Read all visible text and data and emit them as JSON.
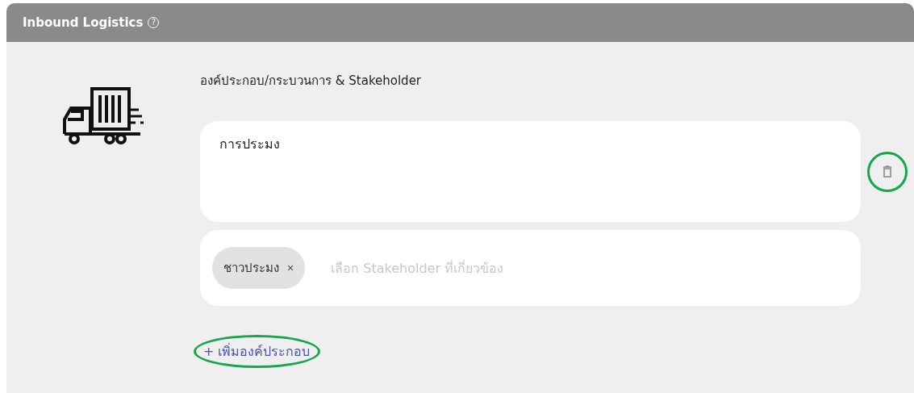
{
  "panel": {
    "title": "Inbound Logistics",
    "help_icon": "?"
  },
  "section_label": "องค์ประกอบ/กระบวนการ & Stakeholder",
  "components": [
    {
      "name": "การประมง",
      "delete_highlighted": true,
      "stakeholders": [
        {
          "label": "ชาวประมง",
          "remove": "×"
        }
      ],
      "stakeholder_placeholder": "เลือก Stakeholder ที่เกี่ยวข้อง"
    }
  ],
  "add_link": {
    "label": "+ เพิ่มองค์ประกอบ",
    "highlighted": true
  }
}
